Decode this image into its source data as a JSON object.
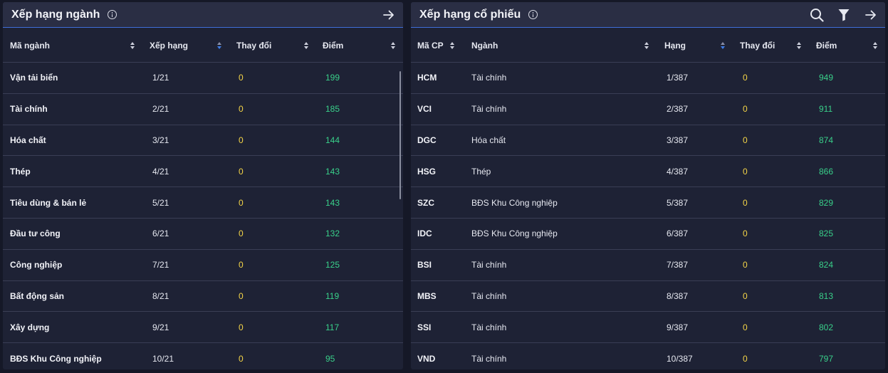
{
  "left_panel": {
    "title": "Xếp hạng ngành",
    "columns": [
      "Mã ngành",
      "Xếp hạng",
      "Thay đổi",
      "Điểm"
    ],
    "rows": [
      {
        "name": "Vận tải biển",
        "rank": "1/21",
        "change": "0",
        "score": "199"
      },
      {
        "name": "Tài chính",
        "rank": "2/21",
        "change": "0",
        "score": "185"
      },
      {
        "name": "Hóa chất",
        "rank": "3/21",
        "change": "0",
        "score": "144"
      },
      {
        "name": "Thép",
        "rank": "4/21",
        "change": "0",
        "score": "143"
      },
      {
        "name": "Tiêu dùng & bán lẻ",
        "rank": "5/21",
        "change": "0",
        "score": "143"
      },
      {
        "name": "Đầu tư công",
        "rank": "6/21",
        "change": "0",
        "score": "132"
      },
      {
        "name": "Công nghiệp",
        "rank": "7/21",
        "change": "0",
        "score": "125"
      },
      {
        "name": "Bất động sản",
        "rank": "8/21",
        "change": "0",
        "score": "119"
      },
      {
        "name": "Xây dựng",
        "rank": "9/21",
        "change": "0",
        "score": "117"
      },
      {
        "name": "BĐS Khu Công nghiệp",
        "rank": "10/21",
        "change": "0",
        "score": "95"
      }
    ]
  },
  "right_panel": {
    "title": "Xếp hạng cổ phiếu",
    "columns": [
      "Mã CP",
      "Ngành",
      "Hạng",
      "Thay đổi",
      "Điểm"
    ],
    "rows": [
      {
        "code": "HCM",
        "sector": "Tài chính",
        "rank": "1/387",
        "change": "0",
        "score": "949"
      },
      {
        "code": "VCI",
        "sector": "Tài chính",
        "rank": "2/387",
        "change": "0",
        "score": "911"
      },
      {
        "code": "DGC",
        "sector": "Hóa chất",
        "rank": "3/387",
        "change": "0",
        "score": "874"
      },
      {
        "code": "HSG",
        "sector": "Thép",
        "rank": "4/387",
        "change": "0",
        "score": "866"
      },
      {
        "code": "SZC",
        "sector": "BĐS Khu Công nghiệp",
        "rank": "5/387",
        "change": "0",
        "score": "829"
      },
      {
        "code": "IDC",
        "sector": "BĐS Khu Công nghiệp",
        "rank": "6/387",
        "change": "0",
        "score": "825"
      },
      {
        "code": "BSI",
        "sector": "Tài chính",
        "rank": "7/387",
        "change": "0",
        "score": "824"
      },
      {
        "code": "MBS",
        "sector": "Tài chính",
        "rank": "8/387",
        "change": "0",
        "score": "813"
      },
      {
        "code": "SSI",
        "sector": "Tài chính",
        "rank": "9/387",
        "change": "0",
        "score": "802"
      },
      {
        "code": "VND",
        "sector": "Tài chính",
        "rank": "10/387",
        "change": "0",
        "score": "797"
      }
    ]
  },
  "colors": {
    "accent": "#3f6fd8",
    "change": "#f5d547",
    "score": "#39d08a",
    "panel_bg": "#1e2235",
    "header_bg": "#2a2e44"
  },
  "icons": {
    "info": "info-icon",
    "arrow": "arrow-right-icon",
    "search": "search-icon",
    "filter": "filter-icon",
    "sort": "sort-icon"
  }
}
